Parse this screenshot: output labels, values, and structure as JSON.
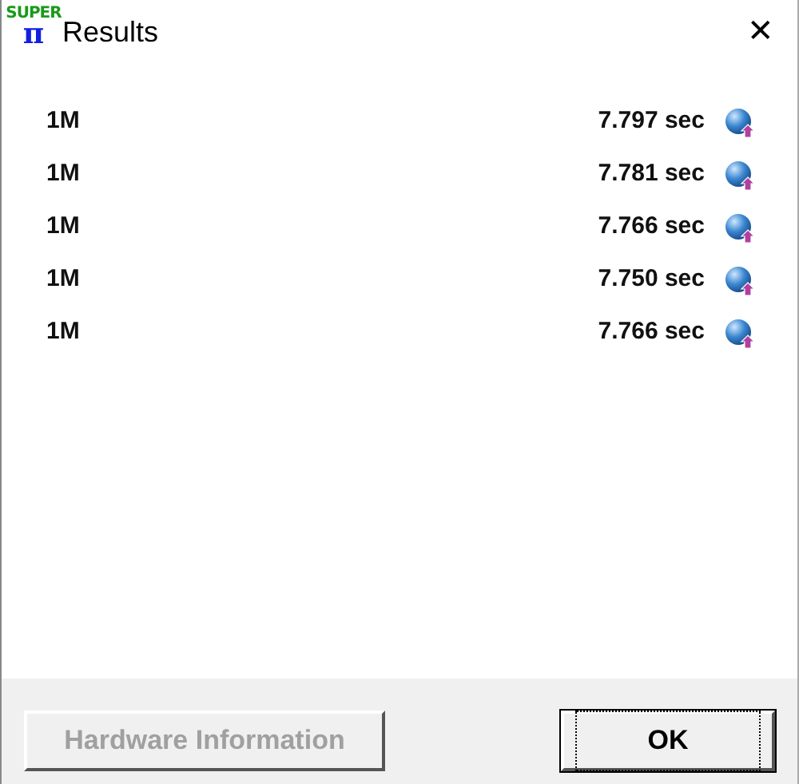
{
  "window": {
    "title": "Results",
    "logo_text": "SUPER",
    "logo_glyph": "π",
    "close": "✕"
  },
  "results": [
    {
      "label": "1M",
      "time": "7.797 sec"
    },
    {
      "label": "1M",
      "time": "7.781 sec"
    },
    {
      "label": "1M",
      "time": "7.766 sec"
    },
    {
      "label": "1M",
      "time": "7.750 sec"
    },
    {
      "label": "1M",
      "time": "7.766 sec"
    }
  ],
  "buttons": [
    {
      "label": "Hardware Information",
      "disabled": true,
      "focused": false
    },
    {
      "label": "OK",
      "disabled": false,
      "focused": true
    }
  ]
}
